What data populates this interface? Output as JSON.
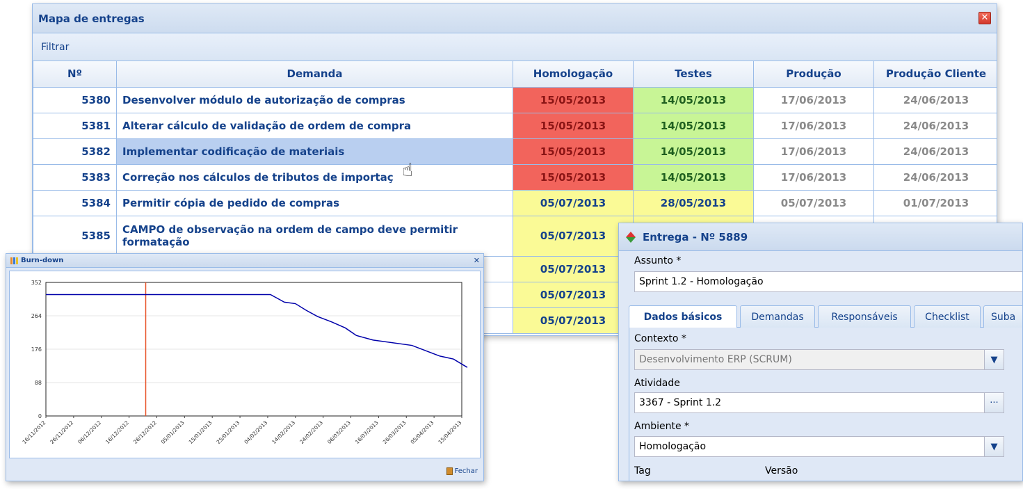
{
  "map_window": {
    "title": "Mapa de entregas",
    "toolbar_filter": "Filtrar",
    "columns": [
      "Nº",
      "Demanda",
      "Homologação",
      "Testes",
      "Produção",
      "Produção Cliente"
    ],
    "rows": [
      {
        "num": "5380",
        "demanda": "Desenvolver módulo de autorização de compras",
        "homologacao": "15/05/2013",
        "testes": "14/05/2013",
        "producao": "17/06/2013",
        "producao_cliente": "24/06/2013"
      },
      {
        "num": "5381",
        "demanda": "Alterar cálculo de validação de ordem de compra",
        "homologacao": "15/05/2013",
        "testes": "14/05/2013",
        "producao": "17/06/2013",
        "producao_cliente": "24/06/2013"
      },
      {
        "num": "5382",
        "demanda": "Implementar codificação de materiais",
        "homologacao": "15/05/2013",
        "testes": "14/05/2013",
        "producao": "17/06/2013",
        "producao_cliente": "24/06/2013"
      },
      {
        "num": "5383",
        "demanda": "Correção nos cálculos de tributos de importaç",
        "homologacao": "15/05/2013",
        "testes": "14/05/2013",
        "producao": "17/06/2013",
        "producao_cliente": "24/06/2013"
      },
      {
        "num": "5384",
        "demanda": "Permitir cópia de pedido de compras",
        "homologacao": "05/07/2013",
        "testes": "28/05/2013",
        "producao": "05/07/2013",
        "producao_cliente": "01/07/2013"
      },
      {
        "num": "5385",
        "demanda": "CAMPO de observação na ordem de campo deve permitir formatação",
        "homologacao": "05/07/2013",
        "testes": "",
        "producao": "",
        "producao_cliente": ""
      },
      {
        "num": "",
        "demanda": "",
        "homologacao": "05/07/2013",
        "testes": "",
        "producao": "",
        "producao_cliente": ""
      },
      {
        "num": "",
        "demanda": "",
        "homologacao": "05/07/2013",
        "testes": "",
        "producao": "",
        "producao_cliente": ""
      },
      {
        "num": "",
        "demanda": "",
        "homologacao": "05/07/2013",
        "testes": "",
        "producao": "",
        "producao_cliente": ""
      }
    ]
  },
  "burn_window": {
    "title": "Burn-down",
    "close_label": "Fechar"
  },
  "chart_data": {
    "type": "line",
    "title": "",
    "xlabel": "",
    "ylabel": "",
    "ylim": [
      0,
      352
    ],
    "yticks": [
      0,
      88,
      176,
      264,
      352
    ],
    "xticks": [
      "16/11/2012",
      "26/11/2012",
      "06/12/2012",
      "16/12/2012",
      "26/12/2012",
      "05/01/2013",
      "15/01/2013",
      "25/01/2013",
      "04/02/2013",
      "14/02/2013",
      "24/02/2013",
      "06/03/2013",
      "16/03/2013",
      "26/03/2013",
      "05/04/2013",
      "15/04/2013"
    ],
    "series": [
      {
        "color": "#0000aa",
        "x": [
          "2012-11-16",
          "2013-02-05",
          "2013-02-08",
          "2013-02-10",
          "2013-02-14",
          "2013-02-18",
          "2013-02-22",
          "2013-02-27",
          "2013-03-04",
          "2013-03-08",
          "2013-03-14",
          "2013-03-28",
          "2013-04-02",
          "2013-04-07",
          "2013-04-12",
          "2013-04-17"
        ],
        "y": [
          320,
          320,
          308,
          300,
          296,
          278,
          262,
          248,
          232,
          212,
          200,
          186,
          172,
          158,
          150,
          128
        ]
      }
    ],
    "vline": {
      "x": "2012-12-22",
      "color": "#e8542a"
    }
  },
  "entrega_window": {
    "title": "Entrega - Nº 5889",
    "assunto_label": "Assunto *",
    "assunto_value": "Sprint 1.2 - Homologação",
    "tabs": [
      "Dados básicos",
      "Demandas",
      "Responsáveis",
      "Checklist",
      "Suba"
    ],
    "contexto_label": "Contexto *",
    "contexto_value": "Desenvolvimento ERP (SCRUM)",
    "atividade_label": "Atividade",
    "atividade_value": "3367 - Sprint 1.2",
    "ambiente_label": "Ambiente *",
    "ambiente_value": "Homologação",
    "tag_label": "Tag",
    "versao_label": "Versão"
  },
  "colors": {
    "header_blue": "#15428b",
    "late_red": "#f2645c",
    "ok_green": "#c8f596",
    "pending_yellow": "#fafa96"
  }
}
